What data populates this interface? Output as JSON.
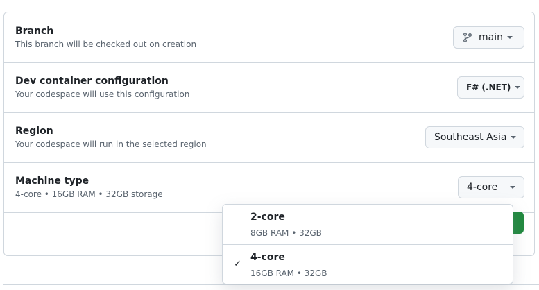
{
  "settings": {
    "branch": {
      "title": "Branch",
      "description": "This branch will be checked out on creation",
      "button_label": "main",
      "icon": "git-branch-icon"
    },
    "devcontainer": {
      "title": "Dev container configuration",
      "description": "Your codespace will use this configuration",
      "button_label": "F# (.NET)"
    },
    "region": {
      "title": "Region",
      "description": "Your codespace will run in the selected region",
      "button_label": "Southeast Asia"
    },
    "machine_type": {
      "title": "Machine type",
      "description": "4-core • 16GB RAM • 32GB storage",
      "button_label": "4-core"
    }
  },
  "machine_menu": {
    "options": [
      {
        "name": "2-core",
        "detail": "8GB RAM • 32GB",
        "selected": false
      },
      {
        "name": "4-core",
        "detail": "16GB RAM • 32GB",
        "selected": true,
        "check": "✓"
      }
    ]
  },
  "colors": {
    "border": "#d0d7de",
    "primary_button": "#1f883d",
    "muted_text": "#59636e"
  }
}
